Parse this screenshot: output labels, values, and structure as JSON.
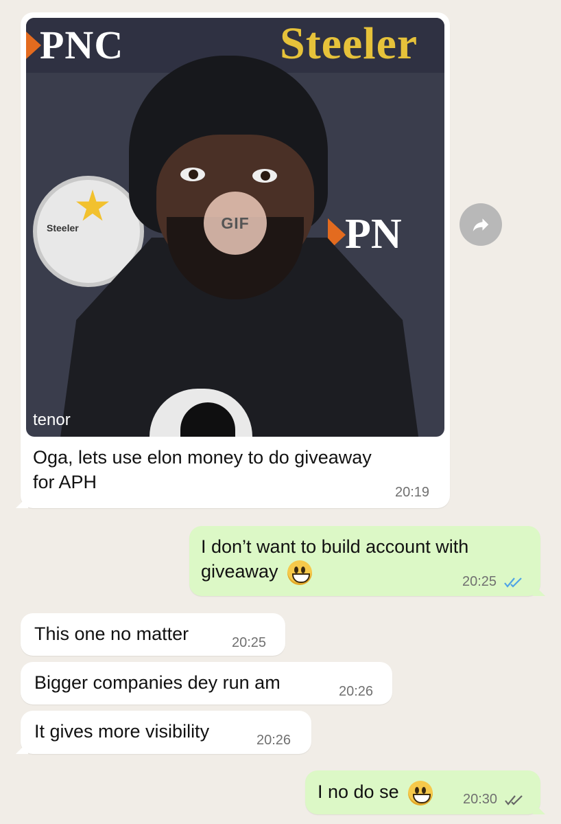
{
  "messages": [
    {
      "id": "m1",
      "direction": "incoming",
      "media": {
        "type": "gif",
        "badge": "GIF",
        "provider": "tenor",
        "scene_text": {
          "pnc_left": "PNC",
          "steelers": "Steeler",
          "logo_label": "Steeler",
          "pnc_right": "PN"
        }
      },
      "text_line1": "Oga, lets use elon money to do giveaway",
      "text_line2": "for APH",
      "time": "20:19"
    },
    {
      "id": "m2",
      "direction": "outgoing",
      "text_line1": "I don’t want to build account with",
      "text_line2": "giveaway",
      "emoji": "grinning-face",
      "time": "20:25",
      "status": "read",
      "status_color": "#4fa3e6"
    },
    {
      "id": "m3",
      "direction": "incoming",
      "text": "This one no matter",
      "time": "20:25"
    },
    {
      "id": "m4",
      "direction": "incoming",
      "text": "Bigger companies dey run am",
      "time": "20:26"
    },
    {
      "id": "m5",
      "direction": "incoming",
      "text": "It gives more visibility",
      "time": "20:26"
    },
    {
      "id": "m6",
      "direction": "outgoing",
      "text": "I no do se",
      "emoji": "grinning-face",
      "time": "20:30",
      "status": "delivered",
      "status_color": "#666666"
    }
  ],
  "forward_icon": "forward-arrow-icon",
  "colors": {
    "background": "#f1ede7",
    "incoming_bubble": "#ffffff",
    "outgoing_bubble": "#dcf8c6"
  }
}
